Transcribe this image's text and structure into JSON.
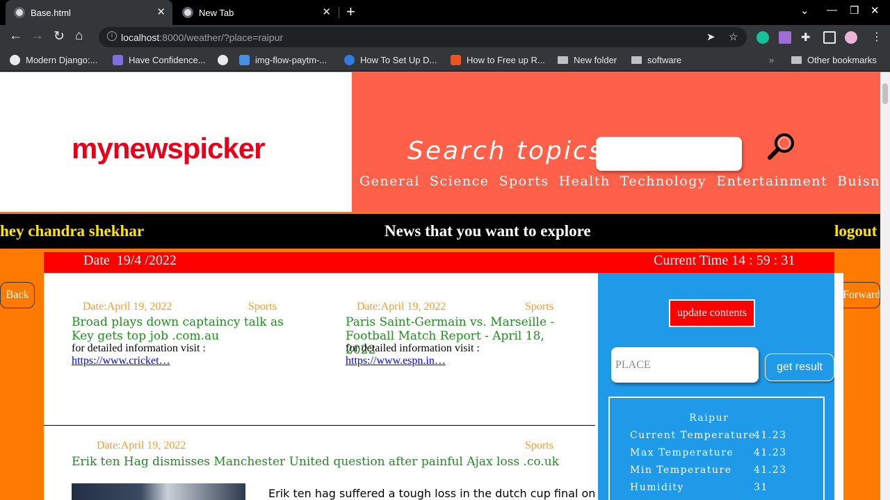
{
  "browser": {
    "tabs": [
      {
        "label": "Base.html",
        "active": true
      },
      {
        "label": "New Tab",
        "active": false
      }
    ],
    "url_host": "localhost",
    "url_rest": ":8000/weather/?place=raipur",
    "bookmarks": [
      "Modern Django:...",
      "Have Confidence...",
      "img-flow-paytm-...",
      "How To Set Up D...",
      "How to Free up R...",
      "New folder",
      "software"
    ],
    "other_bookmarks": "Other bookmarks",
    "colors": {
      "frame": "#000000",
      "toolbar": "#35363a",
      "omnibox": "#202124"
    }
  },
  "site": {
    "logo": "mynewspicker",
    "search_label": "Search topics",
    "categories": [
      "General",
      "Science",
      "Sports",
      "Health",
      "Technology",
      "Entertainment",
      "Buisness"
    ],
    "greeting": "hey chandra shekhar",
    "tagline": "News that you want to explore",
    "logout": "logout",
    "date_text": "Date  19/4 /2022",
    "time_text": "Current Time 14 : 59 : 31",
    "back": "Back",
    "forward": "Forward",
    "colors": {
      "logo": "#e6001a",
      "header": "#ff604a",
      "page": "#ff7a00",
      "sidebar": "#1f9ae8",
      "datebar": "#ff0000",
      "accent_yellow": "#ffe600"
    }
  },
  "news": [
    {
      "date": "Date:April 19, 2022",
      "category": "Sports",
      "title": "Broad plays down captaincy talk as Key gets top job .com.au",
      "info": "for detailed information visit :",
      "link": "https://www.cricket…"
    },
    {
      "date": "Date:April 19, 2022",
      "category": "Sports",
      "title": "Paris Saint-Germain vs. Marseille - Football Match Report - April 18, 2022",
      "info": "for detailed information visit :",
      "link": "https://www.espn.in…"
    },
    {
      "date": "Date:April 19, 2022",
      "category": "Sports",
      "title": "Erik ten Hag dismisses Manchester United question after painful Ajax loss .co.uk",
      "snippet": "Erik ten hag suffered a tough loss in the dutch cup final on"
    }
  ],
  "sidebar": {
    "update_label": "update contents",
    "place_placeholder": "PLACE",
    "get_result": "get result",
    "weather": {
      "city": "Raipur",
      "rows": [
        {
          "label": "Current Temperature",
          "value": "41.23"
        },
        {
          "label": "Max Temperature",
          "value": "41.23"
        },
        {
          "label": "Min Temperature",
          "value": "41.23"
        },
        {
          "label": "Humidity",
          "value": "31"
        }
      ]
    }
  }
}
